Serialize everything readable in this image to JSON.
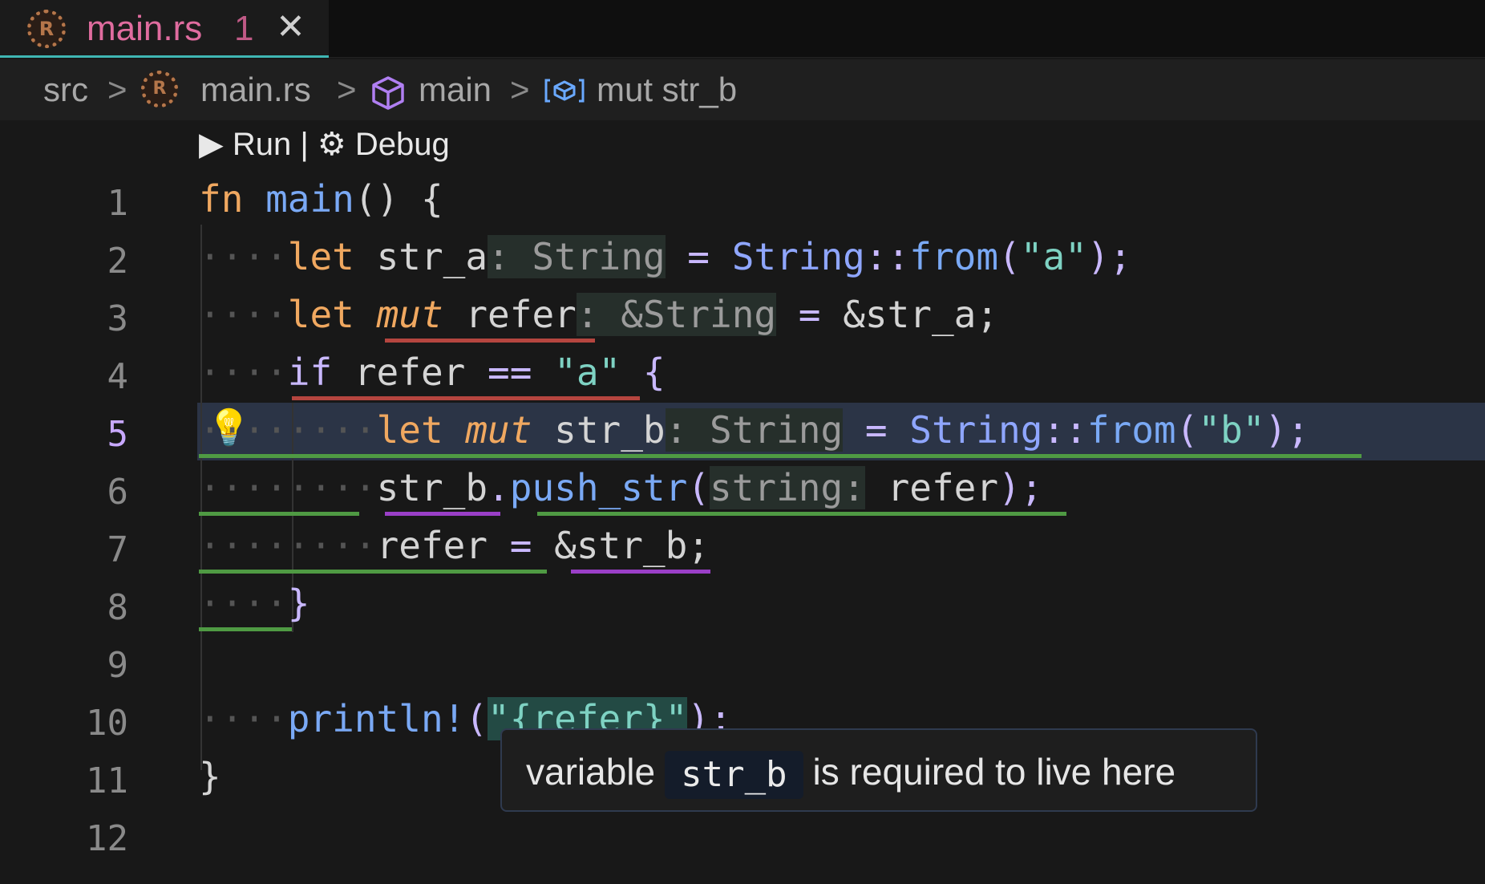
{
  "tab": {
    "title": "main.rs",
    "problem_count": "1",
    "close_glyph": "✕",
    "logo": "R"
  },
  "breadcrumb": {
    "items": [
      "src",
      "main.rs",
      "main",
      "mut str_b"
    ],
    "separator": ">",
    "logo": "R"
  },
  "codelens": {
    "run": "▶ Run",
    "sep": "|",
    "debug": "⚙ Debug"
  },
  "editor": {
    "active_line": 5,
    "line_numbers": [
      "1",
      "2",
      "3",
      "4",
      "5",
      "6",
      "7",
      "8",
      "9",
      "10",
      "11",
      "12"
    ]
  },
  "code": {
    "l1": {
      "kw": "fn",
      "name": "main",
      "rest": "() {"
    },
    "l2": {
      "ws": "····",
      "kw": "let",
      "var": " str_a",
      "hint": ": String",
      "eq": " = ",
      "ty": "String",
      "sep": "::",
      "fn": "from",
      "open": "(",
      "str": "\"a\"",
      "close": ");"
    },
    "l3": {
      "ws": "····",
      "kw": "let",
      "sp": " ",
      "mut": "mut",
      "var": " refer",
      "hint": ": &String",
      "eq": " = ",
      "rest": "&str_a;"
    },
    "l4": {
      "ws": "····",
      "kw": "if",
      "var": " refer",
      "op": " == ",
      "str": "\"a\"",
      "brace": " {"
    },
    "l5": {
      "ws": "········",
      "kw": "let",
      "sp": " ",
      "mut": "mut",
      "var": " str_b",
      "hint": ": String",
      "eq": " = ",
      "ty": "String",
      "sep": "::",
      "fn": "from",
      "open": "(",
      "str": "\"b\"",
      "close": ");"
    },
    "l6": {
      "ws": "········",
      "var": "str_b",
      "dot": ".",
      "fn": "push_str",
      "open": "(",
      "hint": "string:",
      "arg": " refer",
      "close": ");"
    },
    "l7": {
      "ws": "········",
      "var": "refer",
      "eq": " = ",
      "rest": "&str_b;"
    },
    "l8": {
      "ws": "····",
      "brace": "}"
    },
    "l10": {
      "ws": "····",
      "fn": "println!",
      "open": "(",
      "str": "\"{refer}\"",
      "close": ");"
    },
    "l11": {
      "brace": "}"
    }
  },
  "tooltip": {
    "before": "variable",
    "code": "str_b",
    "after": "is required to live here"
  },
  "icons": [
    "rust-logo-icon",
    "close-icon",
    "chevron-right-icon",
    "cube-icon",
    "variable-icon",
    "lightbulb-icon",
    "play-icon",
    "gear-icon"
  ]
}
